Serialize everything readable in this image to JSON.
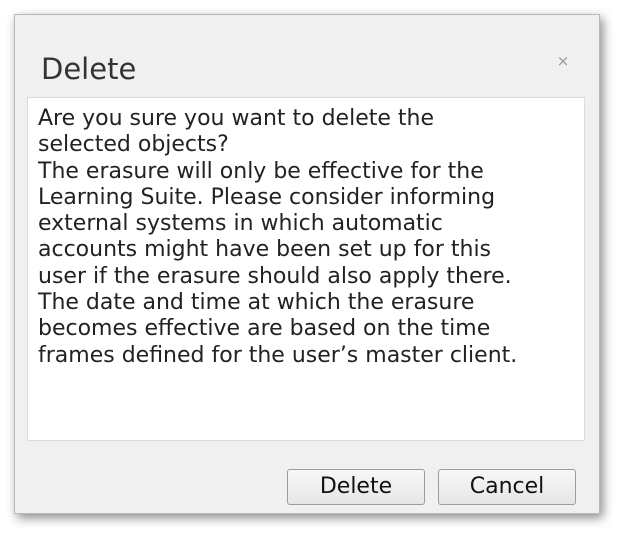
{
  "dialog": {
    "title": "Delete",
    "close_icon": "close-icon",
    "close_glyph": "×",
    "message": "Are you sure you want to delete the\nselected objects?\nThe erasure will only be effective for the\nLearning Suite. Please consider informing\nexternal systems in which automatic\naccounts might have been set up for this\nuser if the erasure should also apply there.\nThe date and time at which the erasure\nbecomes effective are based on the time\nframes defined for the user’s master client.",
    "buttons": {
      "delete_label": "Delete",
      "cancel_label": "Cancel"
    }
  }
}
